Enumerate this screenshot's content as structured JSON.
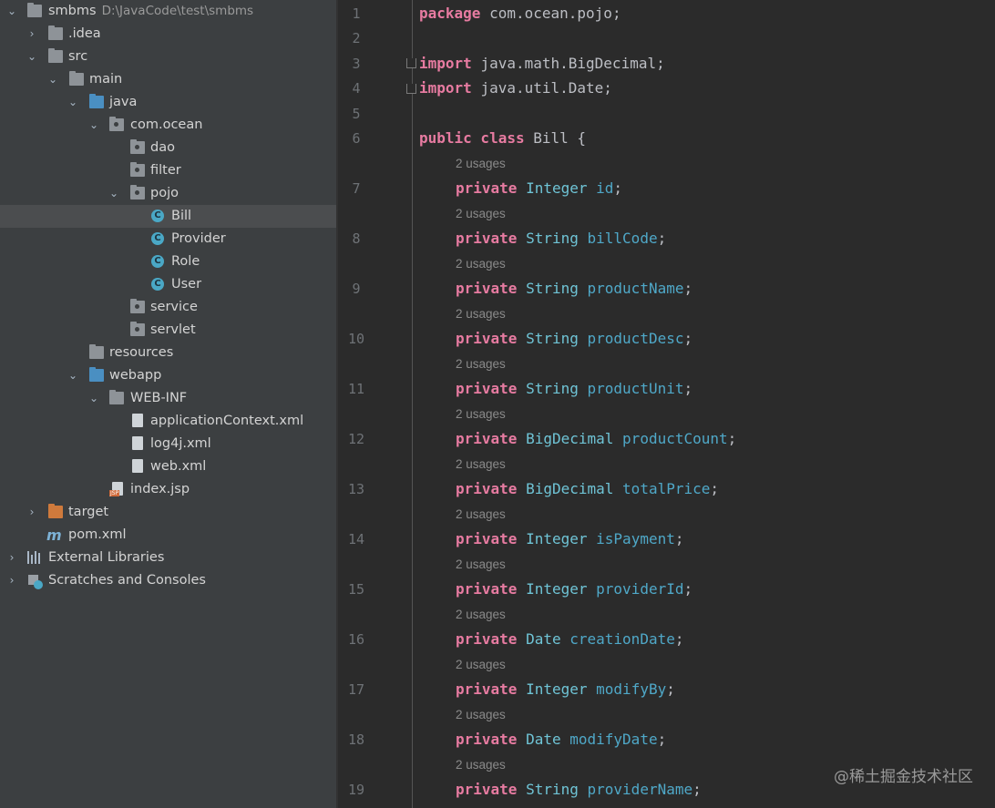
{
  "project_tree": {
    "root": {
      "name": "smbms",
      "path": "D:\\JavaCode\\test\\smbms"
    },
    "items": [
      {
        "label": ".idea"
      },
      {
        "label": "src"
      },
      {
        "label": "main"
      },
      {
        "label": "java"
      },
      {
        "label": "com.ocean"
      },
      {
        "label": "dao"
      },
      {
        "label": "filter"
      },
      {
        "label": "pojo"
      },
      {
        "label": "Bill"
      },
      {
        "label": "Provider"
      },
      {
        "label": "Role"
      },
      {
        "label": "User"
      },
      {
        "label": "service"
      },
      {
        "label": "servlet"
      },
      {
        "label": "resources"
      },
      {
        "label": "webapp"
      },
      {
        "label": "WEB-INF"
      },
      {
        "label": "applicationContext.xml"
      },
      {
        "label": "log4j.xml"
      },
      {
        "label": "web.xml"
      },
      {
        "label": "index.jsp"
      },
      {
        "label": "target"
      },
      {
        "label": "pom.xml"
      },
      {
        "label": "External Libraries"
      },
      {
        "label": "Scratches and Consoles"
      }
    ],
    "selected": "Bill",
    "class_icon_letter": "C",
    "jsp_badge": "JSP",
    "maven_icon_letter": "m"
  },
  "editor": {
    "line_numbers": [
      "1",
      "2",
      "3",
      "4",
      "5",
      "6",
      "7",
      "8",
      "9",
      "10",
      "11",
      "12",
      "13",
      "14",
      "15",
      "16",
      "17",
      "18",
      "19"
    ],
    "usage_hint": "2 usages",
    "package_line": {
      "kw": "package",
      "name": "com.ocean.pojo",
      "end": ";"
    },
    "imports": [
      {
        "kw": "import",
        "name": "java.math.BigDecimal",
        "end": ";"
      },
      {
        "kw": "import",
        "name": "java.util.Date",
        "end": ";"
      }
    ],
    "class_decl": {
      "kw": "public class",
      "name": "Bill",
      "brace": "{"
    },
    "fields": [
      {
        "mod": "private",
        "type": "Integer",
        "name": "id"
      },
      {
        "mod": "private",
        "type": "String",
        "name": "billCode"
      },
      {
        "mod": "private",
        "type": "String",
        "name": "productName"
      },
      {
        "mod": "private",
        "type": "String",
        "name": "productDesc"
      },
      {
        "mod": "private",
        "type": "String",
        "name": "productUnit"
      },
      {
        "mod": "private",
        "type": "BigDecimal",
        "name": "productCount"
      },
      {
        "mod": "private",
        "type": "BigDecimal",
        "name": "totalPrice"
      },
      {
        "mod": "private",
        "type": "Integer",
        "name": "isPayment"
      },
      {
        "mod": "private",
        "type": "Integer",
        "name": "providerId"
      },
      {
        "mod": "private",
        "type": "Date",
        "name": "creationDate"
      },
      {
        "mod": "private",
        "type": "Integer",
        "name": "modifyBy"
      },
      {
        "mod": "private",
        "type": "Date",
        "name": "modifyDate"
      },
      {
        "mod": "private",
        "type": "String",
        "name": "providerName"
      }
    ],
    "semicolon": ";"
  },
  "watermark": "@稀土掘金技术社区",
  "colors": {
    "sidebar_bg": "#3c3f41",
    "editor_bg": "#2b2b2b",
    "selected_row": "#4b4d4f",
    "keyword": "#e77ba1",
    "type": "#6fc4d6",
    "field": "#4fa8c8"
  }
}
